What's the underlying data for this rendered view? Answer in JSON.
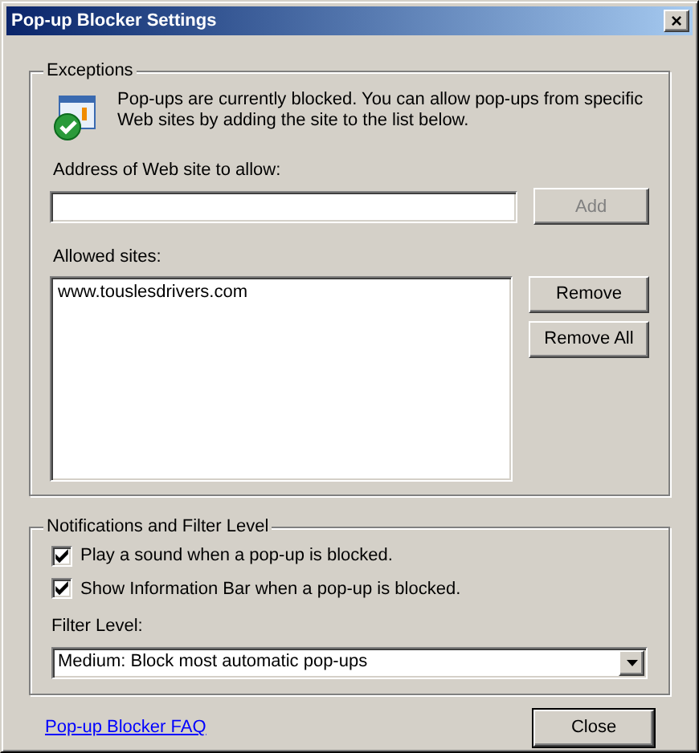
{
  "window": {
    "title": "Pop-up Blocker Settings",
    "close": "×"
  },
  "exceptions": {
    "legend": "Exceptions",
    "message": "Pop-ups are currently blocked.  You can allow pop-ups from specific Web sites by adding the site to the list below.",
    "address_label": "Address of Web site to allow:",
    "add_button": {
      "label": "Add",
      "disabled": true
    },
    "allowed_label": "Allowed sites:",
    "allowed_sites": [
      {
        "text": "www.touslesdrivers.com",
        "selected": false
      }
    ],
    "buttons": [
      "Remove",
      "Remove All"
    ]
  },
  "notifications": {
    "legend": "Notifications and Filter Level",
    "options": [
      {
        "label": "Play a sound when a pop-up is blocked.",
        "checked": true
      },
      {
        "label": "Show Information Bar when a pop-up is blocked.",
        "checked": true
      }
    ],
    "filter_label": "Filter Level:",
    "filter_value": "Medium: Block most automatic pop-ups"
  },
  "footer": {
    "link": "Pop-up Blocker FAQ",
    "close_button": "Close"
  }
}
